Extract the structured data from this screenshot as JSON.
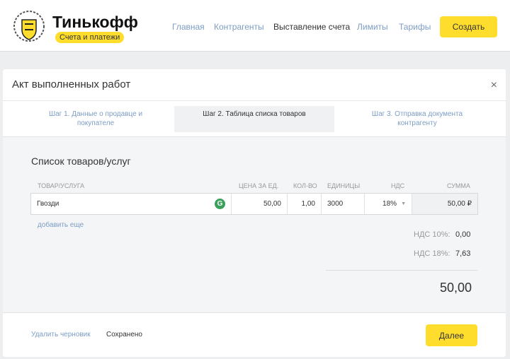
{
  "header": {
    "brand": "Тинькофф",
    "subtitle": "Счета и платежи",
    "nav": [
      "Главная",
      "Контрагенты",
      "Выставление счета",
      "Лимиты",
      "Тарифы"
    ],
    "create": "Создать"
  },
  "modal": {
    "title": "Акт выполненных работ",
    "close": "×",
    "steps": [
      "Шаг 1. Данные о продавце и покупателе",
      "Шаг 2. Таблица списка товаров",
      "Шаг 3. Отправка документа контрагенту"
    ],
    "section_title": "Список товаров/услуг",
    "columns": [
      "ТОВАР/УСЛУГА",
      "ЦЕНА ЗА ЕД.",
      "КОЛ-ВО",
      "ЕДИНИЦЫ",
      "НДС",
      "СУММА"
    ],
    "row": {
      "name": "Гвозди",
      "price": "50,00",
      "qty": "1,00",
      "unit": "3000",
      "vat": "18%",
      "sum": "50,00 ₽"
    },
    "add_more": "добавить еще",
    "vat10_label": "НДС 10%:",
    "vat10": "0,00",
    "vat18_label": "НДС 18%:",
    "vat18": "7,63",
    "total": "50,00",
    "delete_draft": "Удалить черновик",
    "saved": "Сохранено",
    "next": "Далее"
  }
}
